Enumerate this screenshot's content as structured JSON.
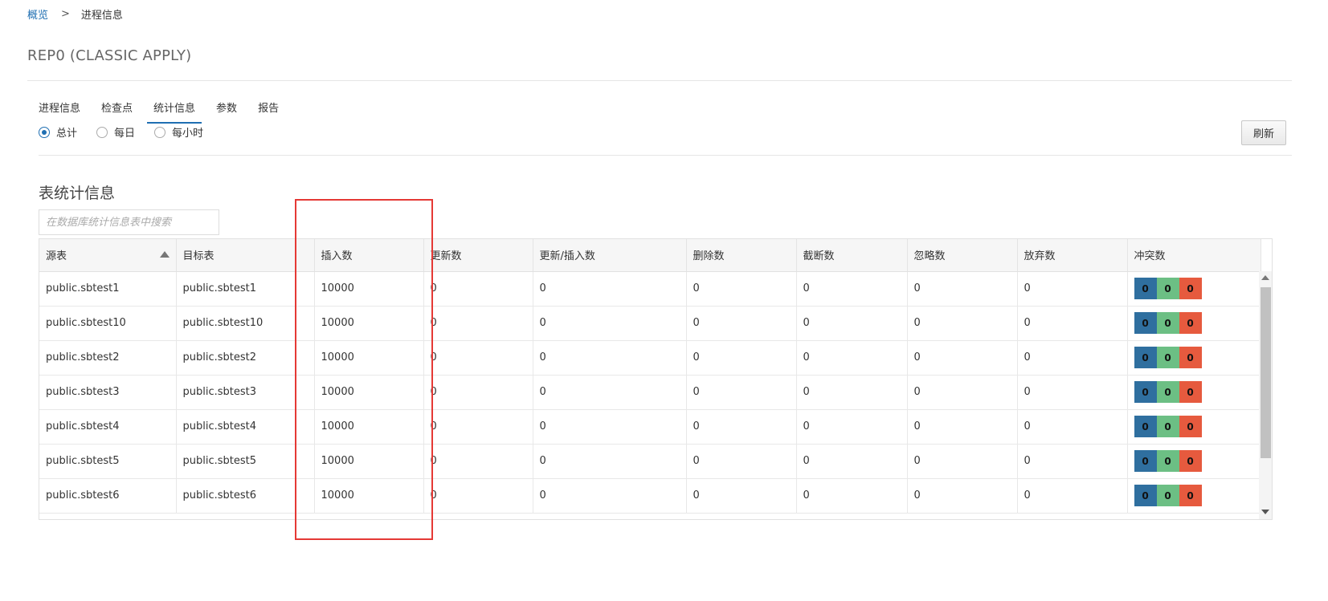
{
  "breadcrumb": {
    "home": "概览",
    "separator": ">",
    "current": "进程信息"
  },
  "page_title": "REP0 (CLASSIC APPLY)",
  "tabs": [
    {
      "label": "进程信息",
      "active": false
    },
    {
      "label": "检查点",
      "active": false
    },
    {
      "label": "统计信息",
      "active": true
    },
    {
      "label": "参数",
      "active": false
    },
    {
      "label": "报告",
      "active": false
    }
  ],
  "radios": [
    {
      "label": "总计",
      "checked": true
    },
    {
      "label": "每日",
      "checked": false
    },
    {
      "label": "每小时",
      "checked": false
    }
  ],
  "refresh_label": "刷新",
  "section_title": "表统计信息",
  "search": {
    "placeholder": "在数据库统计信息表中搜索",
    "value": ""
  },
  "table": {
    "columns": [
      "源表",
      "目标表",
      "插入数",
      "更新数",
      "更新/插入数",
      "删除数",
      "截断数",
      "忽略数",
      "放弃数",
      "冲突数"
    ],
    "sorted_column": "源表",
    "rows": [
      {
        "source": "public.sbtest1",
        "target": "public.sbtest1",
        "inserts": "10000",
        "updates": "0",
        "upserts": "0",
        "deletes": "0",
        "truncates": "0",
        "ignores": "0",
        "discards": "0",
        "conflicts": [
          "0",
          "0",
          "0"
        ]
      },
      {
        "source": "public.sbtest10",
        "target": "public.sbtest10",
        "inserts": "10000",
        "updates": "0",
        "upserts": "0",
        "deletes": "0",
        "truncates": "0",
        "ignores": "0",
        "discards": "0",
        "conflicts": [
          "0",
          "0",
          "0"
        ]
      },
      {
        "source": "public.sbtest2",
        "target": "public.sbtest2",
        "inserts": "10000",
        "updates": "0",
        "upserts": "0",
        "deletes": "0",
        "truncates": "0",
        "ignores": "0",
        "discards": "0",
        "conflicts": [
          "0",
          "0",
          "0"
        ]
      },
      {
        "source": "public.sbtest3",
        "target": "public.sbtest3",
        "inserts": "10000",
        "updates": "0",
        "upserts": "0",
        "deletes": "0",
        "truncates": "0",
        "ignores": "0",
        "discards": "0",
        "conflicts": [
          "0",
          "0",
          "0"
        ]
      },
      {
        "source": "public.sbtest4",
        "target": "public.sbtest4",
        "inserts": "10000",
        "updates": "0",
        "upserts": "0",
        "deletes": "0",
        "truncates": "0",
        "ignores": "0",
        "discards": "0",
        "conflicts": [
          "0",
          "0",
          "0"
        ]
      },
      {
        "source": "public.sbtest5",
        "target": "public.sbtest5",
        "inserts": "10000",
        "updates": "0",
        "upserts": "0",
        "deletes": "0",
        "truncates": "0",
        "ignores": "0",
        "discards": "0",
        "conflicts": [
          "0",
          "0",
          "0"
        ]
      },
      {
        "source": "public.sbtest6",
        "target": "public.sbtest6",
        "inserts": "10000",
        "updates": "0",
        "upserts": "0",
        "deletes": "0",
        "truncates": "0",
        "ignores": "0",
        "discards": "0",
        "conflicts": [
          "0",
          "0",
          "0"
        ]
      }
    ]
  },
  "colors": {
    "accent": "#1f6fb2",
    "conflict_blue": "#2f6f9f",
    "conflict_green": "#6cbf84",
    "conflict_red": "#e65a3e",
    "annotation_red": "#e53935"
  }
}
